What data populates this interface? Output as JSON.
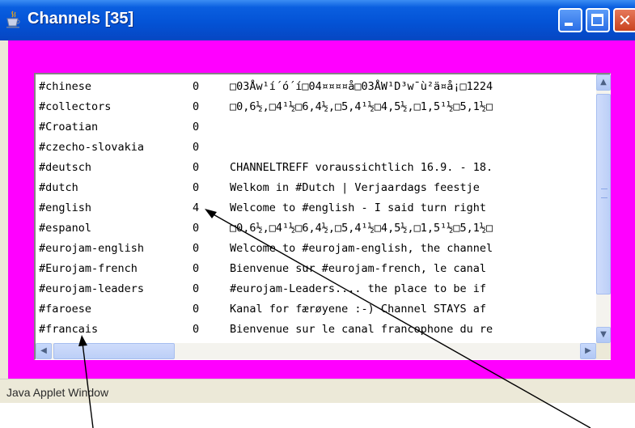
{
  "window": {
    "title": "Channels [35]",
    "status": "Java Applet Window",
    "colors": {
      "client_background": "#ff00ff",
      "titlebar": "#0453d6"
    },
    "title_icon": "java-cup-icon"
  },
  "channels": [
    {
      "name": "#chinese",
      "count": "0",
      "topic": "□03Åw¹í´ó´í□04¤¤¤¤å□03ÅW¹D³w¯ù²ä¤å¡□1224"
    },
    {
      "name": "#collectors",
      "count": "0",
      "topic": "□0,6½,□4¹½□6,4½,□5,4¹½□4,5½,□1,5¹½□5,1½□"
    },
    {
      "name": "#Croatian",
      "count": "0",
      "topic": ""
    },
    {
      "name": "#czecho-slovakia",
      "count": "0",
      "topic": ""
    },
    {
      "name": "#deutsch",
      "count": "0",
      "topic": "CHANNELTREFF voraussichtlich 16.9. - 18."
    },
    {
      "name": "#dutch",
      "count": "0",
      "topic": "Welkom in #Dutch |  Verjaardags feestje"
    },
    {
      "name": "#english",
      "count": "4",
      "topic": "Welcome to #english - I said turn right"
    },
    {
      "name": "#espanol",
      "count": "0",
      "topic": "□0,6½,□4¹½□6,4½,□5,4¹½□4,5½,□1,5¹½□5,1½□"
    },
    {
      "name": "#eurojam-english",
      "count": "0",
      "topic": "Welcome to #eurojam-english, the channel"
    },
    {
      "name": "#Eurojam-french",
      "count": "0",
      "topic": "Bienvenue sur #eurojam-french, le canal"
    },
    {
      "name": "#eurojam-leaders",
      "count": "0",
      "topic": "#eurojam-Leaders.... the place to be if"
    },
    {
      "name": "#faroese",
      "count": "0",
      "topic": "Kanal for færøyene :-)  Channel STAYS af"
    },
    {
      "name": "#francais",
      "count": "0",
      "topic": "Bienvenue sur le canal francophone du re"
    }
  ]
}
